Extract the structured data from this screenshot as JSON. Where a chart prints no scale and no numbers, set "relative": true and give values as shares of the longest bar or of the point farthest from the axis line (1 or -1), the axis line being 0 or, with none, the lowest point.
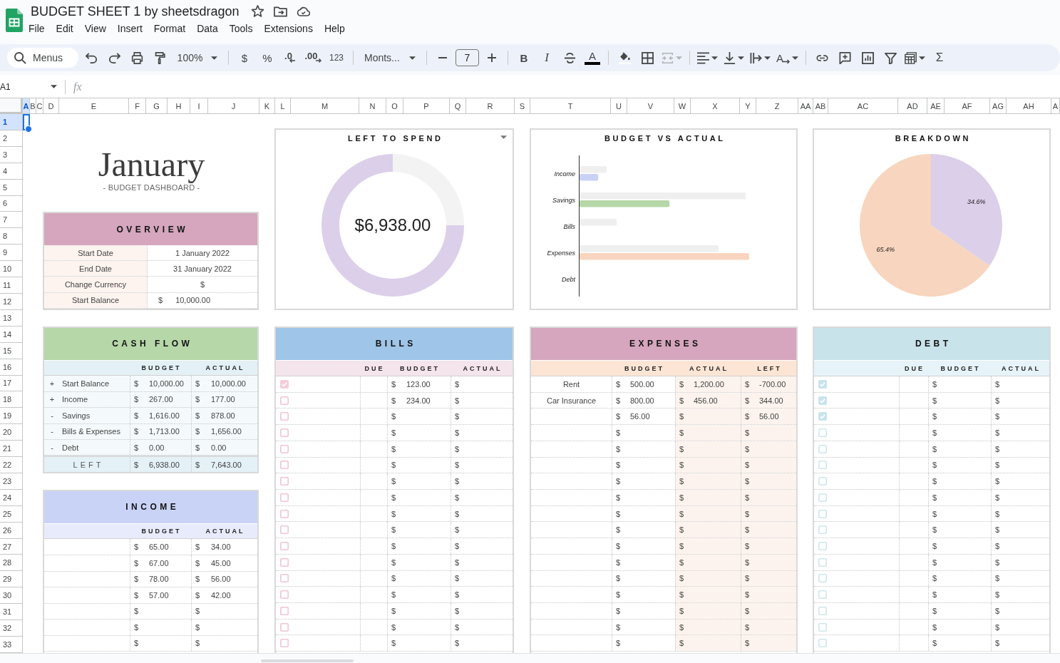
{
  "app": {
    "title": "BUDGET SHEET 1 by sheetsdragon",
    "menus": [
      "File",
      "Edit",
      "View",
      "Insert",
      "Format",
      "Data",
      "Tools",
      "Extensions",
      "Help"
    ]
  },
  "toolbar": {
    "search": "Menus",
    "zoom": "100%",
    "currency_format": "$",
    "percent_format": "%",
    "decrease_decimals": ".0",
    "increase_decimals": ".00",
    "more_formats": "123",
    "font": "Monts...",
    "font_size": "7",
    "bold": "B",
    "italic": "I",
    "text_color": "A",
    "merge_cells": {
      "disabled": true
    },
    "text_rotation": "A",
    "functions": "Σ"
  },
  "formula_bar": {
    "name_box": "A1",
    "fx": "fx"
  },
  "sheet": {
    "columns": [
      {
        "label": "A",
        "selected": true
      },
      {
        "label": "B",
        "selected": false
      },
      {
        "label": "C",
        "selected": false
      },
      {
        "label": "D",
        "selected": false
      },
      {
        "label": "E",
        "selected": false
      },
      {
        "label": "F",
        "selected": false
      },
      {
        "label": "G",
        "selected": false
      },
      {
        "label": "H",
        "selected": false
      },
      {
        "label": "I",
        "selected": false
      },
      {
        "label": "J",
        "selected": false
      },
      {
        "label": "K",
        "selected": false
      },
      {
        "label": "L",
        "selected": false
      },
      {
        "label": "M",
        "selected": false
      },
      {
        "label": "N",
        "selected": false
      },
      {
        "label": "O",
        "selected": false
      },
      {
        "label": "P",
        "selected": false
      },
      {
        "label": "Q",
        "selected": false
      },
      {
        "label": "R",
        "selected": false
      },
      {
        "label": "S",
        "selected": false
      },
      {
        "label": "T",
        "selected": false
      },
      {
        "label": "U",
        "selected": false
      },
      {
        "label": "V",
        "selected": false
      },
      {
        "label": "W",
        "selected": false
      },
      {
        "label": "X",
        "selected": false
      },
      {
        "label": "Y",
        "selected": false
      },
      {
        "label": "Z",
        "selected": false
      },
      {
        "label": "AA",
        "selected": false
      },
      {
        "label": "AB",
        "selected": false
      },
      {
        "label": "AC",
        "selected": false
      },
      {
        "label": "AD",
        "selected": false
      },
      {
        "label": "AE",
        "selected": false
      },
      {
        "label": "AF",
        "selected": false
      },
      {
        "label": "AG",
        "selected": false
      },
      {
        "label": "AH",
        "selected": false
      },
      {
        "label": "A",
        "selected": false
      }
    ],
    "rows": [
      {
        "label": "1",
        "selected": true
      },
      {
        "label": "2",
        "selected": false
      },
      {
        "label": "3",
        "selected": false
      },
      {
        "label": "4",
        "selected": false
      },
      {
        "label": "5",
        "selected": false
      },
      {
        "label": "6",
        "selected": false
      },
      {
        "label": "7",
        "selected": false
      },
      {
        "label": "8",
        "selected": false
      },
      {
        "label": "9",
        "selected": false
      },
      {
        "label": "10",
        "selected": false
      },
      {
        "label": "11",
        "selected": false
      },
      {
        "label": "12",
        "selected": false
      },
      {
        "label": "13",
        "selected": false
      },
      {
        "label": "14",
        "selected": false
      },
      {
        "label": "15",
        "selected": false
      },
      {
        "label": "16",
        "selected": false
      },
      {
        "label": "17",
        "selected": false
      },
      {
        "label": "18",
        "selected": false
      },
      {
        "label": "19",
        "selected": false
      },
      {
        "label": "20",
        "selected": false
      },
      {
        "label": "21",
        "selected": false
      },
      {
        "label": "22",
        "selected": false
      },
      {
        "label": "23",
        "selected": false
      },
      {
        "label": "24",
        "selected": false
      },
      {
        "label": "25",
        "selected": false
      },
      {
        "label": "26",
        "selected": false
      },
      {
        "label": "27",
        "selected": false
      },
      {
        "label": "28",
        "selected": false
      },
      {
        "label": "29",
        "selected": false
      },
      {
        "label": "30",
        "selected": false
      },
      {
        "label": "31",
        "selected": false
      },
      {
        "label": "32",
        "selected": false
      },
      {
        "label": "33",
        "selected": false
      }
    ]
  },
  "dashboard": {
    "title": "January",
    "subtitle": "- BUDGET DASHBOARD -",
    "overview": {
      "title": "OVERVIEW",
      "rows": [
        {
          "label": "Start Date",
          "value": "1 January 2022"
        },
        {
          "label": "End Date",
          "value": "31 January 2022"
        },
        {
          "label": "Change Currency",
          "value": "$"
        },
        {
          "label": "Start Balance",
          "symbol": "$",
          "value": "10,000.00"
        }
      ]
    },
    "left_to_spend": {
      "chart_data": {
        "type": "donut",
        "title": "LEFT TO SPEND",
        "values": [
          25,
          75
        ],
        "colors": [
          "#f3f3f3",
          "#dccfea"
        ],
        "relative": true
      },
      "amount": "$6,938.00"
    },
    "budget_vs_actual": {
      "chart_data": {
        "type": "bar",
        "orientation": "horizontal",
        "title": "BUDGET VS ACTUAL",
        "categories": [
          "Income",
          "Savings",
          "Bills",
          "Expenses",
          "Debt"
        ],
        "relative": true,
        "series": [
          {
            "color": "#efefef",
            "values": [
              0.16,
              0.98,
              0.22,
              0.82,
              0
            ]
          },
          {
            "colors": [
              "#c9d2f6",
              "#b6d7a8",
              null,
              "#f8d5be",
              null
            ],
            "values": [
              0.11,
              0.53,
              0,
              1,
              0
            ]
          }
        ]
      }
    },
    "breakdown": {
      "chart_data": {
        "type": "pie",
        "title": "BREAKDOWN",
        "values": [
          34.6,
          65.4
        ],
        "colors": [
          "#dccfea",
          "#f8d5be"
        ],
        "value_labels": [
          "34.6%",
          "65.4%"
        ]
      }
    },
    "cash_flow": {
      "title": "CASH FLOW",
      "columns": [
        "BUDGET",
        "ACTUAL"
      ],
      "rows": [
        {
          "sign": "+",
          "label": "Start Balance",
          "budget": {
            "symbol": "$",
            "amount": "10,000.00"
          },
          "actual": {
            "symbol": "$",
            "amount": "10,000.00"
          }
        },
        {
          "sign": "+",
          "label": "Income",
          "budget": {
            "symbol": "$",
            "amount": "267.00"
          },
          "actual": {
            "symbol": "$",
            "amount": "177.00"
          }
        },
        {
          "sign": "-",
          "label": "Savings",
          "budget": {
            "symbol": "$",
            "amount": "1,616.00"
          },
          "actual": {
            "symbol": "$",
            "amount": "878.00"
          }
        },
        {
          "sign": "-",
          "label": "Bills & Expenses",
          "budget": {
            "symbol": "$",
            "amount": "1,713.00"
          },
          "actual": {
            "symbol": "$",
            "amount": "1,656.00"
          }
        },
        {
          "sign": "-",
          "label": "Debt",
          "budget": {
            "symbol": "$",
            "amount": "0.00"
          },
          "actual": {
            "symbol": "$",
            "amount": "0.00"
          }
        }
      ],
      "total": {
        "label": "LEFT",
        "budget": {
          "symbol": "$",
          "amount": "6,938.00"
        },
        "actual": {
          "symbol": "$",
          "amount": "7,643.00"
        }
      }
    },
    "income": {
      "title": "INCOME",
      "columns": [
        "BUDGET",
        "ACTUAL"
      ],
      "rows": [
        {
          "budget": {
            "symbol": "$",
            "amount": "65.00"
          },
          "actual": {
            "symbol": "$",
            "amount": "34.00"
          }
        },
        {
          "budget": {
            "symbol": "$",
            "amount": "67.00"
          },
          "actual": {
            "symbol": "$",
            "amount": "45.00"
          }
        },
        {
          "budget": {
            "symbol": "$",
            "amount": "78.00"
          },
          "actual": {
            "symbol": "$",
            "amount": "56.00"
          }
        },
        {
          "budget": {
            "symbol": "$",
            "amount": "57.00"
          },
          "actual": {
            "symbol": "$",
            "amount": "42.00"
          }
        },
        {
          "budget": {
            "symbol": "$"
          },
          "actual": {
            "symbol": "$"
          }
        },
        {
          "budget": {
            "symbol": "$"
          },
          "actual": {
            "symbol": "$"
          }
        },
        {
          "budget": {
            "symbol": "$"
          },
          "actual": {
            "symbol": "$"
          }
        }
      ]
    },
    "bills": {
      "title": "BILLS",
      "columns": [
        "DUE",
        "BUDGET",
        "ACTUAL"
      ],
      "rows": [
        {
          "checked": true,
          "budget": {
            "symbol": "$",
            "amount": "123.00"
          },
          "actual": {
            "symbol": "$"
          }
        },
        {
          "checked": false,
          "budget": {
            "symbol": "$",
            "amount": "234.00"
          },
          "actual": {
            "symbol": "$"
          }
        },
        {
          "checked": false,
          "budget": {
            "symbol": "$"
          },
          "actual": {
            "symbol": "$"
          }
        },
        {
          "checked": false,
          "budget": {
            "symbol": "$"
          },
          "actual": {
            "symbol": "$"
          }
        },
        {
          "checked": false,
          "budget": {
            "symbol": "$"
          },
          "actual": {
            "symbol": "$"
          }
        },
        {
          "checked": false,
          "budget": {
            "symbol": "$"
          },
          "actual": {
            "symbol": "$"
          }
        },
        {
          "checked": false,
          "budget": {
            "symbol": "$"
          },
          "actual": {
            "symbol": "$"
          }
        },
        {
          "checked": false,
          "budget": {
            "symbol": "$"
          },
          "actual": {
            "symbol": "$"
          }
        },
        {
          "checked": false,
          "budget": {
            "symbol": "$"
          },
          "actual": {
            "symbol": "$"
          }
        },
        {
          "checked": false,
          "budget": {
            "symbol": "$"
          },
          "actual": {
            "symbol": "$"
          }
        },
        {
          "checked": false,
          "budget": {
            "symbol": "$"
          },
          "actual": {
            "symbol": "$"
          }
        },
        {
          "checked": false,
          "budget": {
            "symbol": "$"
          },
          "actual": {
            "symbol": "$"
          }
        },
        {
          "checked": false,
          "budget": {
            "symbol": "$"
          },
          "actual": {
            "symbol": "$"
          }
        },
        {
          "checked": false,
          "budget": {
            "symbol": "$"
          },
          "actual": {
            "symbol": "$"
          }
        },
        {
          "checked": false,
          "budget": {
            "symbol": "$"
          },
          "actual": {
            "symbol": "$"
          }
        },
        {
          "checked": false,
          "budget": {
            "symbol": "$"
          },
          "actual": {
            "symbol": "$"
          }
        },
        {
          "checked": false,
          "budget": {
            "symbol": "$"
          },
          "actual": {
            "symbol": "$"
          }
        }
      ]
    },
    "expenses": {
      "title": "EXPENSES",
      "columns": [
        "BUDGET",
        "ACTUAL",
        "LEFT"
      ],
      "rows": [
        {
          "label": "Rent",
          "budget": {
            "symbol": "$",
            "amount": "500.00"
          },
          "actual": {
            "symbol": "$",
            "amount": "1,200.00"
          },
          "left": {
            "symbol": "$",
            "amount": "-700.00"
          }
        },
        {
          "label": "Car Insurance",
          "budget": {
            "symbol": "$",
            "amount": "800.00"
          },
          "actual": {
            "symbol": "$",
            "amount": "456.00"
          },
          "left": {
            "symbol": "$",
            "amount": "344.00"
          }
        },
        {
          "budget": {
            "symbol": "$",
            "amount": "56.00"
          },
          "actual": {
            "symbol": "$"
          },
          "left": {
            "symbol": "$",
            "amount": "56.00"
          }
        },
        {
          "budget": {
            "symbol": "$"
          },
          "actual": {
            "symbol": "$"
          },
          "left": {
            "symbol": "$"
          }
        },
        {
          "budget": {
            "symbol": "$"
          },
          "actual": {
            "symbol": "$"
          },
          "left": {
            "symbol": "$"
          }
        },
        {
          "budget": {
            "symbol": "$"
          },
          "actual": {
            "symbol": "$"
          },
          "left": {
            "symbol": "$"
          }
        },
        {
          "budget": {
            "symbol": "$"
          },
          "actual": {
            "symbol": "$"
          },
          "left": {
            "symbol": "$"
          }
        },
        {
          "budget": {
            "symbol": "$"
          },
          "actual": {
            "symbol": "$"
          },
          "left": {
            "symbol": "$"
          }
        },
        {
          "budget": {
            "symbol": "$"
          },
          "actual": {
            "symbol": "$"
          },
          "left": {
            "symbol": "$"
          }
        },
        {
          "budget": {
            "symbol": "$"
          },
          "actual": {
            "symbol": "$"
          },
          "left": {
            "symbol": "$"
          }
        },
        {
          "budget": {
            "symbol": "$"
          },
          "actual": {
            "symbol": "$"
          },
          "left": {
            "symbol": "$"
          }
        },
        {
          "budget": {
            "symbol": "$"
          },
          "actual": {
            "symbol": "$"
          },
          "left": {
            "symbol": "$"
          }
        },
        {
          "budget": {
            "symbol": "$"
          },
          "actual": {
            "symbol": "$"
          },
          "left": {
            "symbol": "$"
          }
        },
        {
          "budget": {
            "symbol": "$"
          },
          "actual": {
            "symbol": "$"
          },
          "left": {
            "symbol": "$"
          }
        },
        {
          "budget": {
            "symbol": "$"
          },
          "actual": {
            "symbol": "$"
          },
          "left": {
            "symbol": "$"
          }
        },
        {
          "budget": {
            "symbol": "$"
          },
          "actual": {
            "symbol": "$"
          },
          "left": {
            "symbol": "$"
          }
        },
        {
          "budget": {
            "symbol": "$"
          },
          "actual": {
            "symbol": "$"
          },
          "left": {
            "symbol": "$"
          }
        }
      ]
    },
    "debt": {
      "title": "DEBT",
      "columns": [
        "DUE",
        "BUDGET",
        "ACTUAL"
      ],
      "rows": [
        {
          "checked": true,
          "budget": {
            "symbol": "$"
          },
          "actual": {
            "symbol": "$"
          }
        },
        {
          "checked": true,
          "budget": {
            "symbol": "$"
          },
          "actual": {
            "symbol": "$"
          }
        },
        {
          "checked": true,
          "budget": {
            "symbol": "$"
          },
          "actual": {
            "symbol": "$"
          }
        },
        {
          "checked": false,
          "budget": {
            "symbol": "$"
          },
          "actual": {
            "symbol": "$"
          }
        },
        {
          "checked": false,
          "budget": {
            "symbol": "$"
          },
          "actual": {
            "symbol": "$"
          }
        },
        {
          "checked": false,
          "budget": {
            "symbol": "$"
          },
          "actual": {
            "symbol": "$"
          }
        },
        {
          "checked": false,
          "budget": {
            "symbol": "$"
          },
          "actual": {
            "symbol": "$"
          }
        },
        {
          "checked": false,
          "budget": {
            "symbol": "$"
          },
          "actual": {
            "symbol": "$"
          }
        },
        {
          "checked": false,
          "budget": {
            "symbol": "$"
          },
          "actual": {
            "symbol": "$"
          }
        },
        {
          "checked": false,
          "budget": {
            "symbol": "$"
          },
          "actual": {
            "symbol": "$"
          }
        },
        {
          "checked": false,
          "budget": {
            "symbol": "$"
          },
          "actual": {
            "symbol": "$"
          }
        },
        {
          "checked": false,
          "budget": {
            "symbol": "$"
          },
          "actual": {
            "symbol": "$"
          }
        },
        {
          "checked": false,
          "budget": {
            "symbol": "$"
          },
          "actual": {
            "symbol": "$"
          }
        },
        {
          "checked": false,
          "budget": {
            "symbol": "$"
          },
          "actual": {
            "symbol": "$"
          }
        },
        {
          "checked": false,
          "budget": {
            "symbol": "$"
          },
          "actual": {
            "symbol": "$"
          }
        },
        {
          "checked": false,
          "budget": {
            "symbol": "$"
          },
          "actual": {
            "symbol": "$"
          }
        },
        {
          "checked": false,
          "budget": {
            "symbol": "$"
          },
          "actual": {
            "symbol": "$"
          }
        }
      ]
    }
  }
}
